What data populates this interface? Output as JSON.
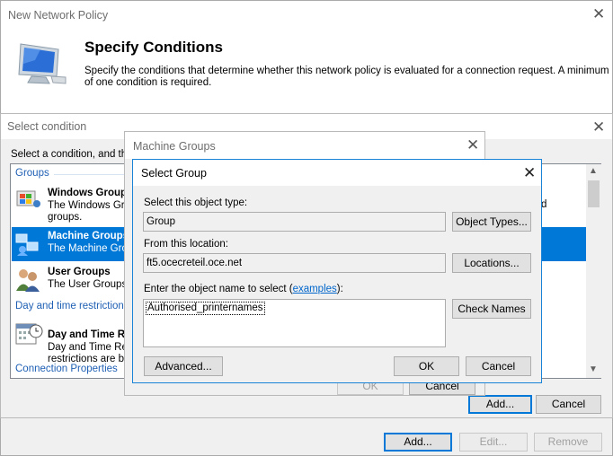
{
  "main_window": {
    "title": "New Network Policy",
    "heading": "Specify Conditions",
    "description_line1": "Specify the conditions that determine whether this network policy is evaluated for a connection request. A minimum",
    "description_line2": "of one condition is required.",
    "buttons": {
      "add": "Add...",
      "edit": "Edit...",
      "remove": "Remove"
    }
  },
  "select_condition": {
    "title": "Select condition",
    "instruction": "Select a condition, and then",
    "categories": {
      "groups": "Groups",
      "day_time": "Day and time restrictions",
      "connection": "Connection Properties"
    },
    "items": [
      {
        "title": "Windows Groups",
        "desc1": "The Windows Gro",
        "desc2": "groups."
      },
      {
        "title": "Machine Groups",
        "desc1": "The Machine Grou"
      },
      {
        "title": "User Groups",
        "desc1": "The User Groups"
      },
      {
        "title": "Day and Time Re",
        "desc1": "Day and Time Re",
        "desc2": "restrictions are ba"
      }
    ],
    "right_fragment": "d",
    "buttons": {
      "add": "Add...",
      "cancel": "Cancel"
    }
  },
  "machine_groups": {
    "title": "Machine Groups",
    "buttons": {
      "ok": "OK",
      "cancel": "Cancel"
    }
  },
  "select_group": {
    "title": "Select Group",
    "object_type_label": "Select this object type:",
    "object_type_value": "Group",
    "object_types_button": "Object Types...",
    "location_label": "From this location:",
    "location_value": "ft5.ocecreteil.oce.net",
    "locations_button": "Locations...",
    "enter_label_prefix": "Enter the object name to select (",
    "examples_link": "examples",
    "enter_label_suffix": "):",
    "object_name_value": "Authorised_printernames",
    "check_names_button": "Check Names",
    "advanced_button": "Advanced...",
    "ok_button": "OK",
    "cancel_button": "Cancel"
  }
}
